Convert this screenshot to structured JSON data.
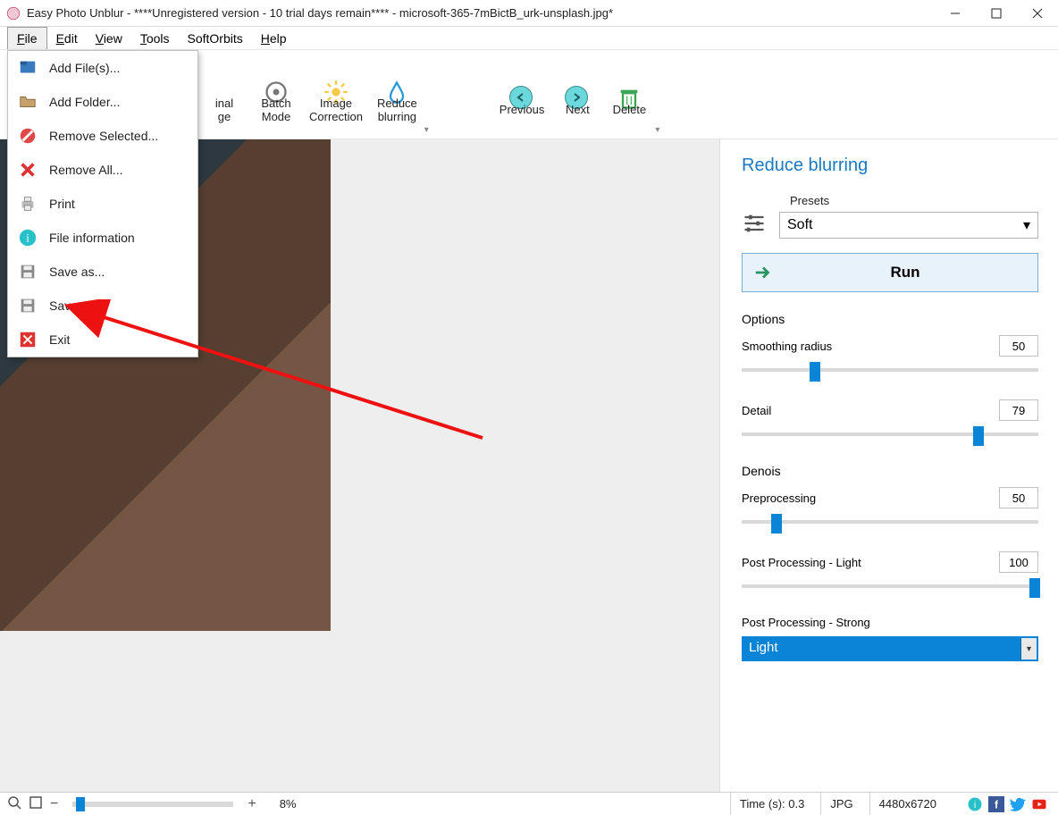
{
  "window": {
    "title": "Easy Photo Unblur - ****Unregistered version - 10 trial days remain**** - microsoft-365-7mBictB_urk-unsplash.jpg*"
  },
  "menubar": {
    "items": [
      "File",
      "Edit",
      "View",
      "Tools",
      "SoftOrbits",
      "Help"
    ]
  },
  "file_menu": {
    "items": [
      {
        "label": "Add File(s)...",
        "icon": "file-add"
      },
      {
        "label": "Add Folder...",
        "icon": "folder"
      },
      {
        "label": "Remove Selected...",
        "icon": "remove-circle"
      },
      {
        "label": "Remove All...",
        "icon": "remove-x"
      },
      {
        "label": "Print",
        "icon": "printer"
      },
      {
        "label": "File information",
        "icon": "info"
      },
      {
        "label": "Save as...",
        "icon": "floppy"
      },
      {
        "label": "Save",
        "icon": "floppy"
      },
      {
        "label": "Exit",
        "icon": "close-red"
      }
    ]
  },
  "toolbar": {
    "original_image_partial": "inal\nge",
    "batch_mode": "Batch\nMode",
    "image_correction": "Image\nCorrection",
    "reduce_blurring": "Reduce\nblurring",
    "previous": "Previous",
    "next": "Next",
    "delete": "Delete"
  },
  "panel": {
    "title": "Reduce blurring",
    "presets_label": "Presets",
    "presets_value": "Soft",
    "run": "Run",
    "options_label": "Options",
    "smoothing_radius": {
      "label": "Smoothing radius",
      "value": "50",
      "pct": 23
    },
    "detail": {
      "label": "Detail",
      "value": "79",
      "pct": 78
    },
    "denoise_partial": "Denois",
    "preprocessing": {
      "label": "Preprocessing",
      "value": "50",
      "pct": 10
    },
    "postprocessing_light": {
      "label": "Post Processing - Light",
      "value": "100",
      "pct": 97
    },
    "postprocessing_strong_label": "Post Processing - Strong",
    "postprocessing_strong_value": "Light"
  },
  "status": {
    "zoom_pct": "8%",
    "time": "Time (s): 0.3",
    "format": "JPG",
    "dimensions": "4480x6720"
  }
}
